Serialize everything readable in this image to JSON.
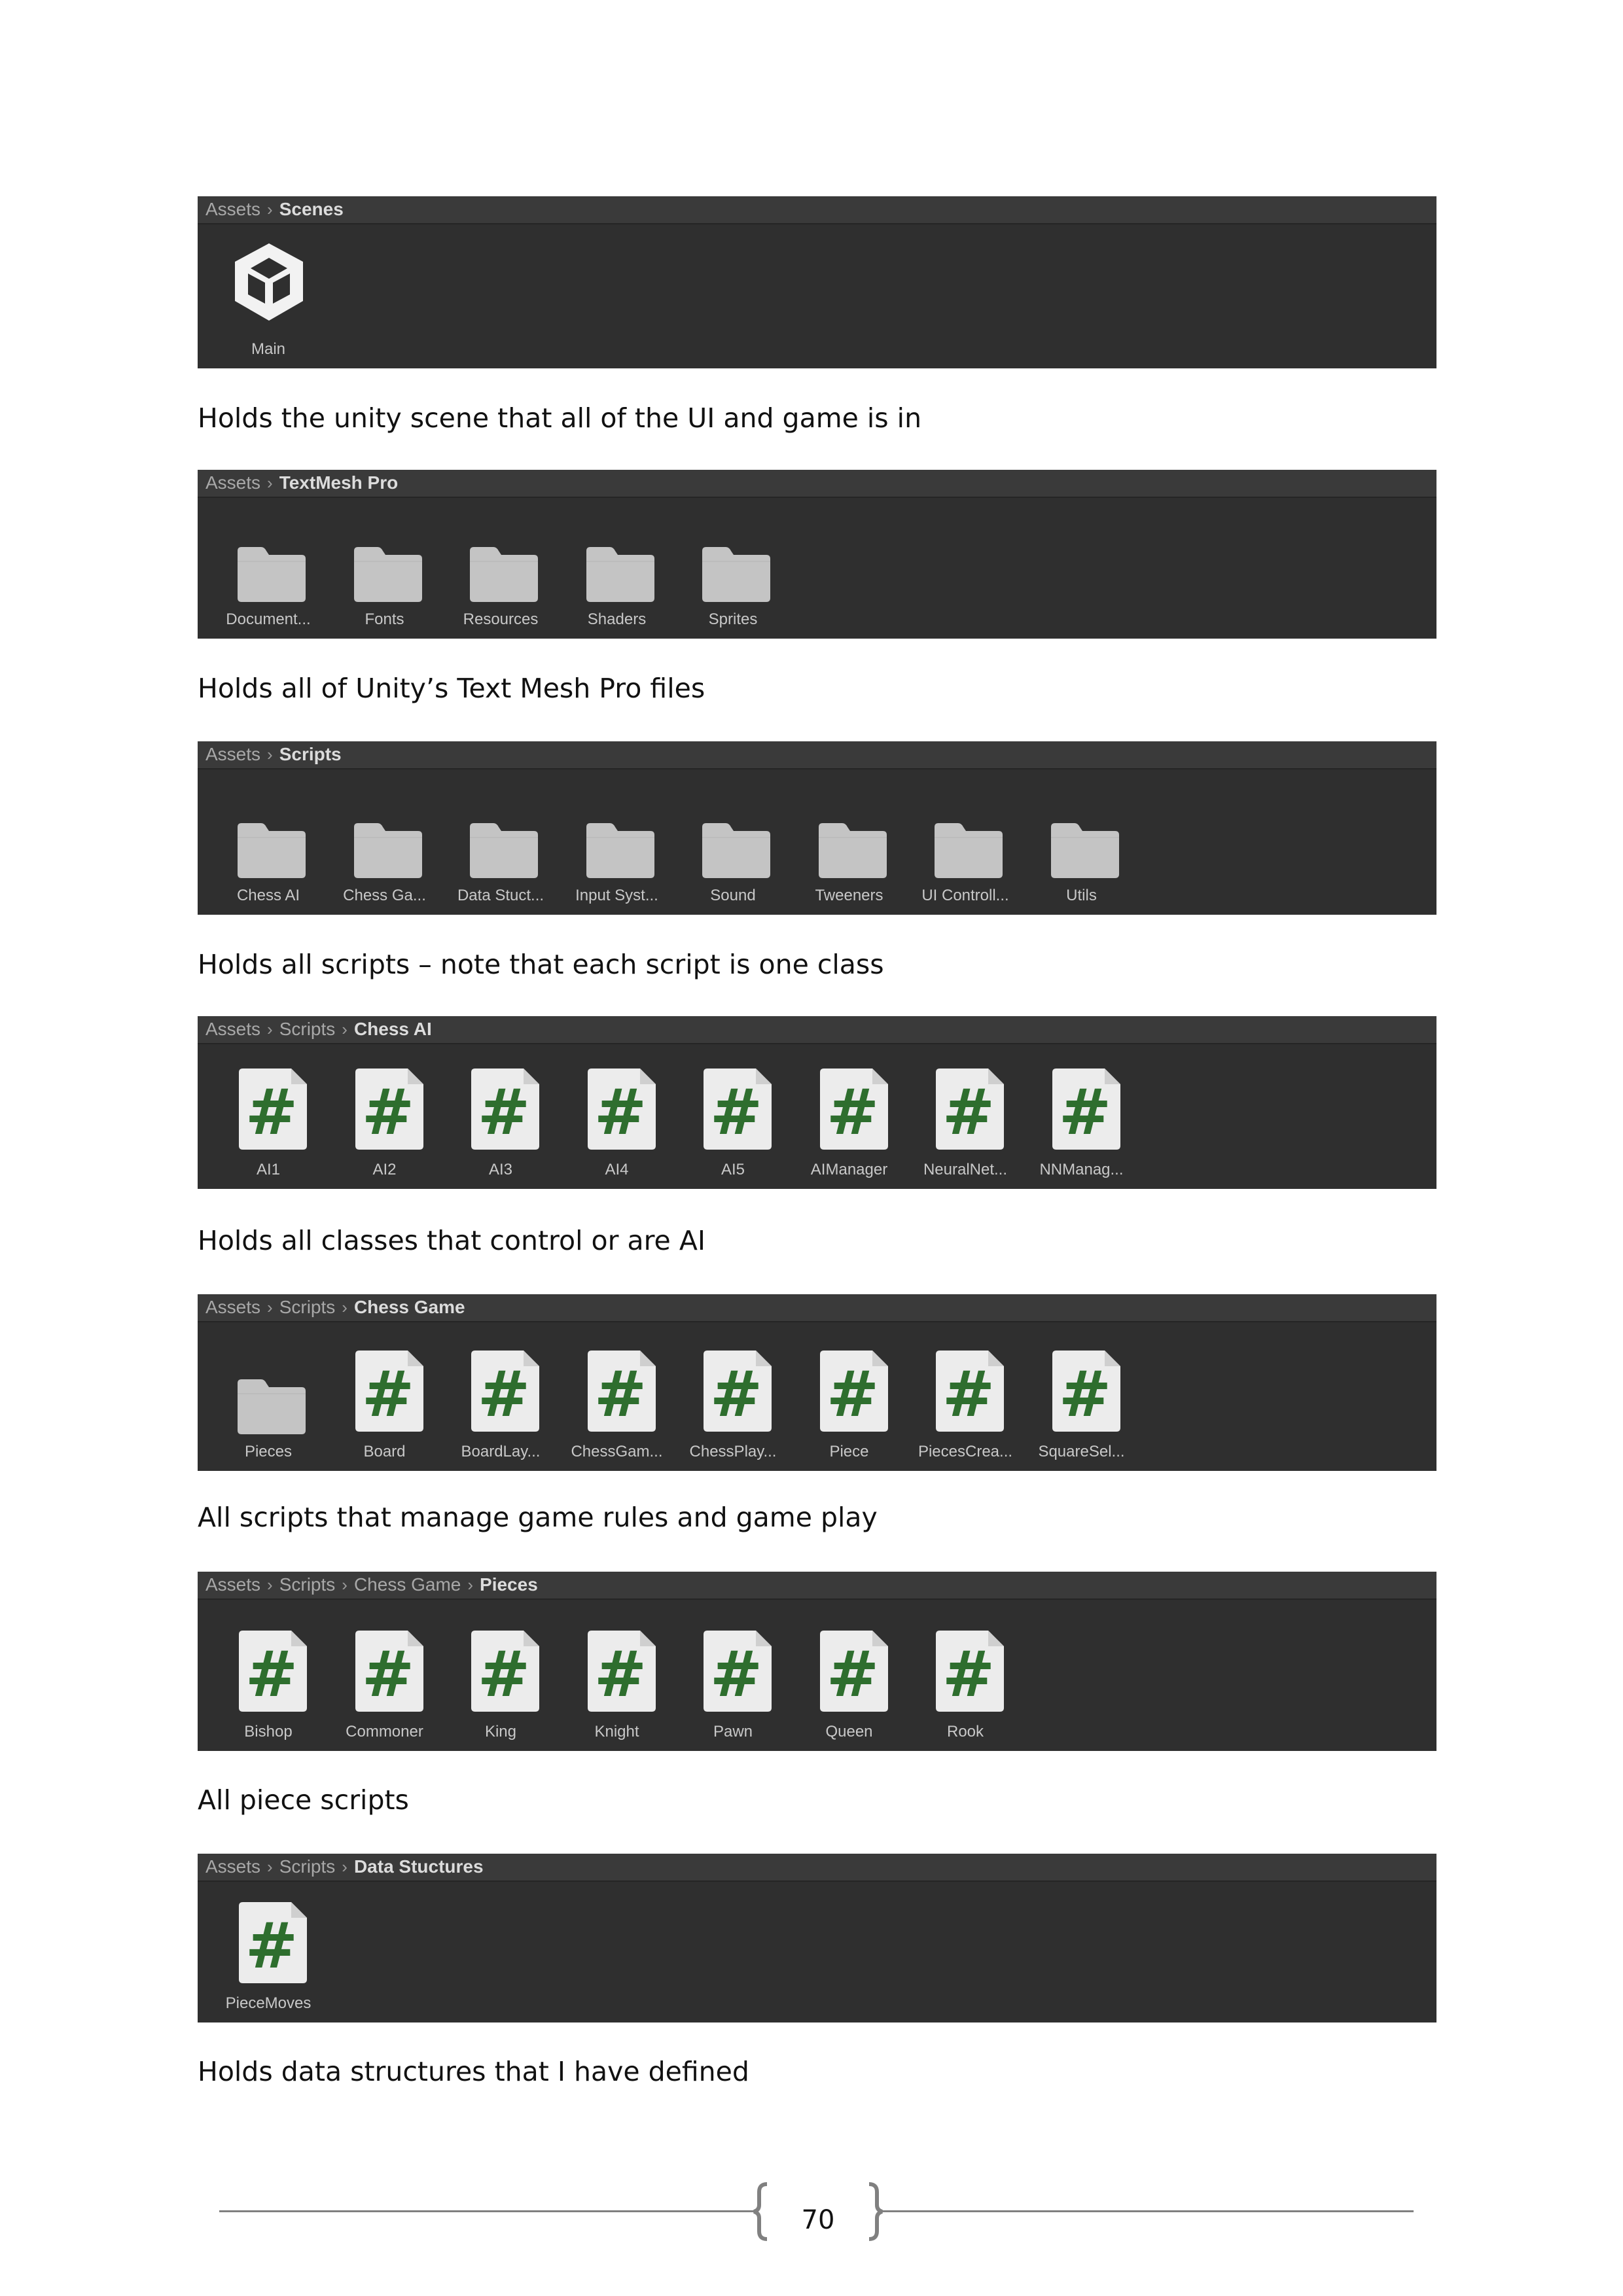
{
  "panels": [
    {
      "breadcrumb": [
        "Assets"
      ],
      "current": "Scenes",
      "items": [
        {
          "label": "Main",
          "icon": "unity-scene-icon"
        }
      ]
    },
    {
      "breadcrumb": [
        "Assets"
      ],
      "current": "TextMesh Pro",
      "items": [
        {
          "label": "Document...",
          "icon": "folder-icon"
        },
        {
          "label": "Fonts",
          "icon": "folder-icon"
        },
        {
          "label": "Resources",
          "icon": "folder-icon"
        },
        {
          "label": "Shaders",
          "icon": "folder-icon"
        },
        {
          "label": "Sprites",
          "icon": "folder-icon"
        }
      ]
    },
    {
      "breadcrumb": [
        "Assets"
      ],
      "current": "Scripts",
      "items": [
        {
          "label": "Chess AI",
          "icon": "folder-icon"
        },
        {
          "label": "Chess Ga...",
          "icon": "folder-icon"
        },
        {
          "label": "Data Stuct...",
          "icon": "folder-icon"
        },
        {
          "label": "Input Syst...",
          "icon": "folder-icon"
        },
        {
          "label": "Sound",
          "icon": "folder-icon"
        },
        {
          "label": "Tweeners",
          "icon": "folder-icon"
        },
        {
          "label": "UI Controll...",
          "icon": "folder-icon"
        },
        {
          "label": "Utils",
          "icon": "folder-icon"
        }
      ]
    },
    {
      "breadcrumb": [
        "Assets",
        "Scripts"
      ],
      "current": "Chess AI",
      "items": [
        {
          "label": "AI1",
          "icon": "csharp-script-icon"
        },
        {
          "label": "AI2",
          "icon": "csharp-script-icon"
        },
        {
          "label": "AI3",
          "icon": "csharp-script-icon"
        },
        {
          "label": "AI4",
          "icon": "csharp-script-icon"
        },
        {
          "label": "AI5",
          "icon": "csharp-script-icon"
        },
        {
          "label": "AIManager",
          "icon": "csharp-script-icon"
        },
        {
          "label": "NeuralNet...",
          "icon": "csharp-script-icon"
        },
        {
          "label": "NNManag...",
          "icon": "csharp-script-icon"
        }
      ]
    },
    {
      "breadcrumb": [
        "Assets",
        "Scripts"
      ],
      "current": "Chess Game",
      "items": [
        {
          "label": "Pieces",
          "icon": "folder-icon"
        },
        {
          "label": "Board",
          "icon": "csharp-script-icon"
        },
        {
          "label": "BoardLay...",
          "icon": "csharp-script-icon"
        },
        {
          "label": "ChessGam...",
          "icon": "csharp-script-icon"
        },
        {
          "label": "ChessPlay...",
          "icon": "csharp-script-icon"
        },
        {
          "label": "Piece",
          "icon": "csharp-script-icon"
        },
        {
          "label": "PiecesCrea...",
          "icon": "csharp-script-icon"
        },
        {
          "label": "SquareSel...",
          "icon": "csharp-script-icon"
        }
      ]
    },
    {
      "breadcrumb": [
        "Assets",
        "Scripts",
        "Chess Game"
      ],
      "current": "Pieces",
      "items": [
        {
          "label": "Bishop",
          "icon": "csharp-script-icon"
        },
        {
          "label": "Commoner",
          "icon": "csharp-script-icon"
        },
        {
          "label": "King",
          "icon": "csharp-script-icon"
        },
        {
          "label": "Knight",
          "icon": "csharp-script-icon"
        },
        {
          "label": "Pawn",
          "icon": "csharp-script-icon"
        },
        {
          "label": "Queen",
          "icon": "csharp-script-icon"
        },
        {
          "label": "Rook",
          "icon": "csharp-script-icon"
        }
      ]
    },
    {
      "breadcrumb": [
        "Assets",
        "Scripts"
      ],
      "current": "Data Stuctures",
      "items": [
        {
          "label": "PieceMoves",
          "icon": "csharp-script-icon"
        }
      ]
    }
  ],
  "captions": [
    "Holds the unity scene that all of the UI and game is in",
    "Holds all of Unity’s Text Mesh Pro files",
    "Holds all scripts – note that each script is one class",
    "Holds all classes that control or are AI",
    "All scripts that manage game rules and game play",
    "All piece scripts",
    "Holds data structures that I have defined"
  ],
  "page_number": "70",
  "colors": {
    "panel_bg": "#2f2f2f",
    "breadcrumb_bg": "#3a3a3a",
    "folder": "#c4c4c4",
    "script_hash": "#2e6e2e"
  }
}
